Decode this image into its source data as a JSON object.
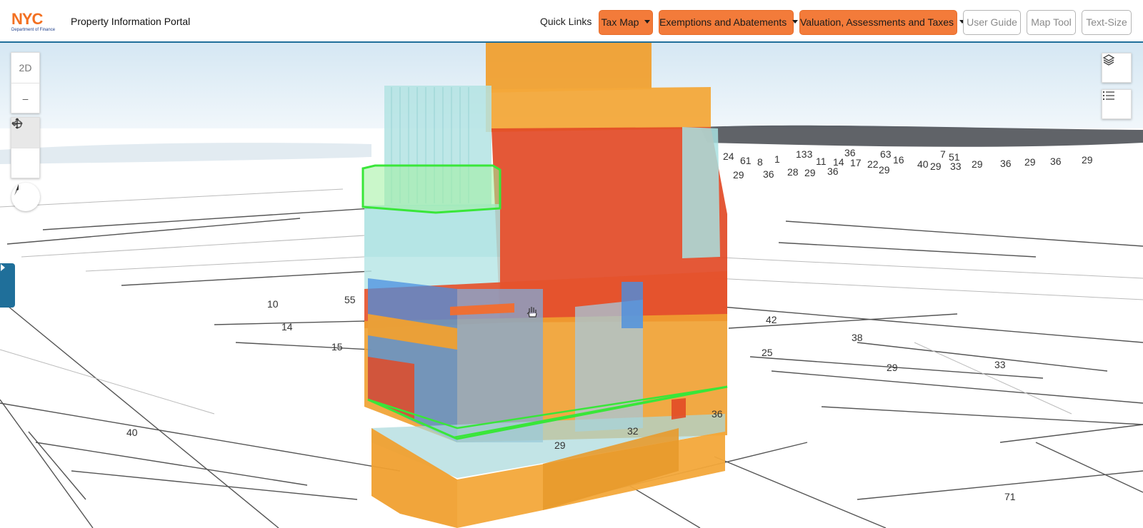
{
  "header": {
    "logo_text": "NYC",
    "logo_subtitle": "Department of Finance",
    "title": "Property Information Portal",
    "quick_links": "Quick Links",
    "menus": [
      {
        "label": "Tax Map"
      },
      {
        "label": "Exemptions and Abatements"
      },
      {
        "label": "Valuation, Assessments and Taxes"
      }
    ],
    "buttons": [
      {
        "label": "User Guide"
      },
      {
        "label": "Map Tool"
      },
      {
        "label": "Text-Size"
      }
    ]
  },
  "map_controls": {
    "view_mode": "2D",
    "zoom_out": "–"
  },
  "lot_labels": [
    "24",
    "61",
    "8",
    "1",
    "133",
    "36",
    "11",
    "14",
    "17",
    "22",
    "63",
    "16",
    "7",
    "51",
    "40",
    "29",
    "33",
    "29",
    "36",
    "29",
    "36",
    "29",
    "29",
    "36",
    "28",
    "29",
    "36",
    "29",
    "10",
    "55",
    "14",
    "15",
    "42",
    "38",
    "25",
    "29",
    "33",
    "36",
    "32",
    "29",
    "40",
    "71"
  ],
  "colors": {
    "accent": "#f37b3a",
    "header_border": "#1f6f9a",
    "selection": "#39e639",
    "building_orange": "#f0a030",
    "building_red": "#e24a26",
    "building_cyan": "#a8e0e0",
    "building_blue": "#4a8fe0"
  }
}
